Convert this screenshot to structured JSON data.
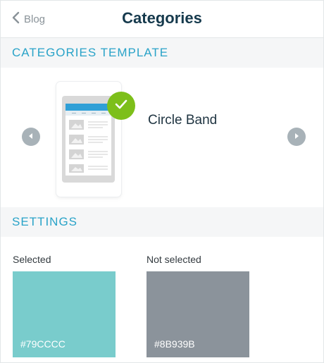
{
  "header": {
    "back_label": "Blog",
    "title": "Categories"
  },
  "sections": {
    "template_header": "CATEGORIES TEMPLATE",
    "settings_header": "SETTINGS"
  },
  "template": {
    "name": "Circle Band",
    "selected": true
  },
  "settings": {
    "selected": {
      "label": "Selected",
      "color": "#79CCCC",
      "color_text": "#79CCCC"
    },
    "not_selected": {
      "label": "Not selected",
      "color": "#8B939B",
      "color_text": "#8B939B"
    }
  },
  "colors": {
    "accent": "#29A3C8",
    "title": "#163A4D",
    "check": "#7DBF1A",
    "nav_button": "#A8B2B8"
  },
  "icons": {
    "back": "chevron-left-icon",
    "prev": "arrow-left-icon",
    "next": "arrow-right-icon",
    "check": "checkmark-icon"
  }
}
